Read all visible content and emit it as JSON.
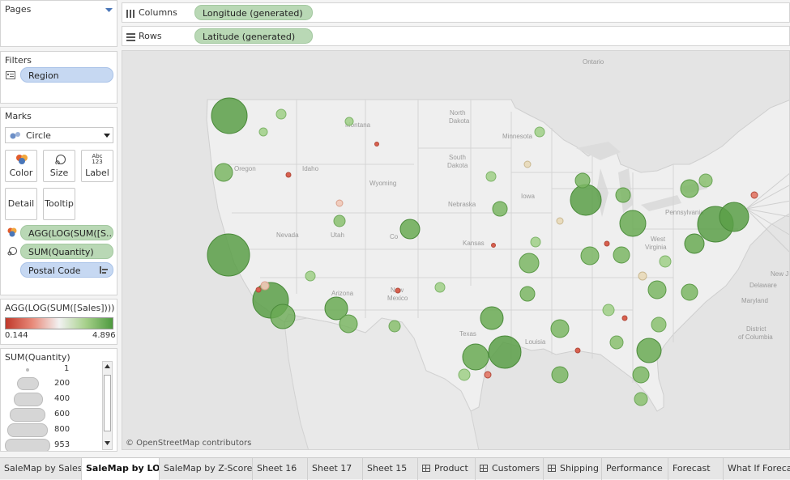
{
  "pages": {
    "title": "Pages"
  },
  "filters": {
    "title": "Filters",
    "items": [
      {
        "label": "Region"
      }
    ]
  },
  "shelves": {
    "columns": {
      "label": "Columns",
      "pill": "Longitude (generated)"
    },
    "rows": {
      "label": "Rows",
      "pill": "Latitude (generated)"
    }
  },
  "marks": {
    "title": "Marks",
    "mark_type": "Circle",
    "buttons": {
      "color": "Color",
      "size": "Size",
      "label": "Label",
      "detail": "Detail",
      "tooltip": "Tooltip"
    },
    "label_icon_text": "Abc\n123",
    "fields": [
      {
        "label": "AGG(LOG(SUM([S..."
      },
      {
        "label": "SUM(Quantity)"
      },
      {
        "label": "Postal Code"
      }
    ]
  },
  "color_legend": {
    "title": "AGG(LOG(SUM([Sales])))",
    "min": "0.144",
    "max": "4.896",
    "colors": {
      "low": "#c0392b",
      "mid": "#f2f2f2",
      "high": "#4e9a3f"
    }
  },
  "size_legend": {
    "title": "SUM(Quantity)",
    "values": [
      "1",
      "200",
      "400",
      "600",
      "800",
      "953"
    ]
  },
  "map": {
    "attribution": "© OpenStreetMap contributors",
    "labels": {
      "ontario": "Ontario",
      "north_dakota_1": "North",
      "north_dakota_2": "Dakota",
      "montana": "Montana",
      "minnesota": "Minnesota",
      "oregon": "Oregon",
      "idaho": "Idaho",
      "south_dakota_1": "South",
      "south_dakota_2": "Dakota",
      "wyoming": "Wyoming",
      "nebraska": "Nebraska",
      "iowa": "Iowa",
      "nevada": "Nevada",
      "utah": "Utah",
      "colorado": "Co",
      "kansas": "Kansas",
      "pennsylvania": "Pennsylvania",
      "west_virginia_1": "West",
      "west_virginia_2": "Virginia",
      "new_jersey": "New J",
      "delaware": "Delaware",
      "maryland": "Maryland",
      "district_1": "District",
      "district_2": "of Columbia",
      "arizona": "Arizona",
      "new_mexico_1": "New",
      "new_mexico_2": "Mexico",
      "texas": "Texas",
      "louisiana": "Louisia"
    }
  },
  "tabs": [
    {
      "label": "SaleMap by Sales"
    },
    {
      "label": "SaleMap by LOG",
      "active": true
    },
    {
      "label": "SaleMap by Z-Score"
    },
    {
      "label": "Sheet 16"
    },
    {
      "label": "Sheet 17"
    },
    {
      "label": "Sheet 15"
    },
    {
      "label": "Product",
      "icon": "grid-icon"
    },
    {
      "label": "Customers",
      "icon": "grid-icon"
    },
    {
      "label": "Shipping",
      "icon": "grid-icon"
    },
    {
      "label": "Performance"
    },
    {
      "label": "Forecast"
    },
    {
      "label": "What If Forecast"
    }
  ]
}
